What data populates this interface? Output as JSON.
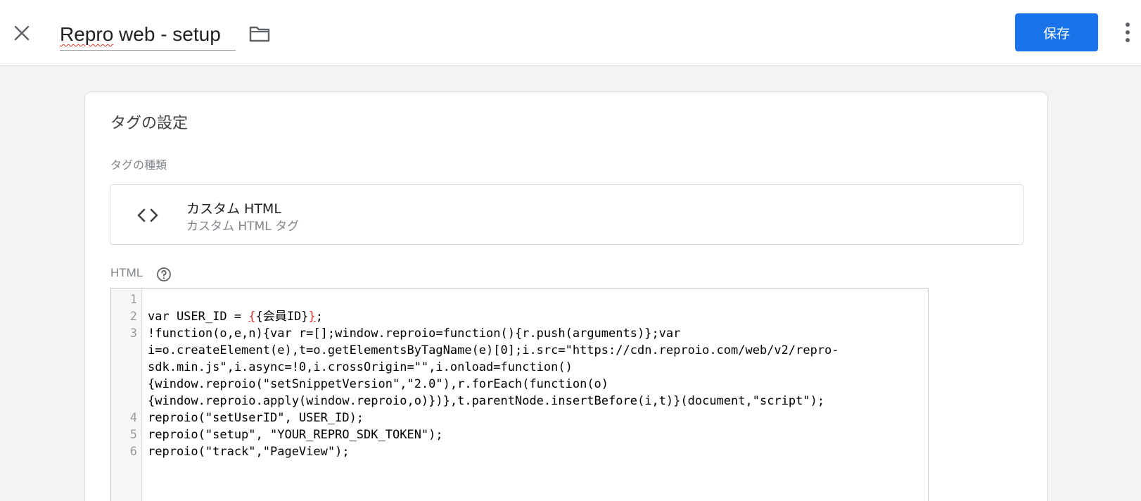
{
  "header": {
    "title_misspelled": "Repro",
    "title_rest": " web - setup",
    "save_label": "保存",
    "icons": [
      "close-icon",
      "folder-icon",
      "more-vert-icon"
    ],
    "accent_color": "#1a73e8"
  },
  "card": {
    "title": "タグの設定",
    "tag_type_label": "タグの種類",
    "tag_type": {
      "name": "カスタム HTML",
      "description": "カスタム HTML タグ",
      "icon": "code-brackets-icon"
    },
    "html_label": "HTML",
    "help_icon": "help-circle-icon"
  },
  "editor": {
    "line_numbers": [
      "1",
      "2",
      "3",
      "4",
      "5",
      "6"
    ],
    "line2_prefix": "var USER_ID = ",
    "line2_open": "{",
    "line2_var": "{会員ID}",
    "line2_close": "}",
    "line2_suffix": ";",
    "line3": "!function(o,e,n){var r=[];window.reproio=function(){r.push(arguments)};var\ni=o.createElement(e),t=o.getElementsByTagName(e)[0];i.src=\"https://cdn.reproio.com/web/v2/repro-\nsdk.min.js\",i.async=!0,i.crossOrigin=\"\",i.onload=function()\n{window.reproio(\"setSnippetVersion\",\"2.0\"),r.forEach(function(o)\n{window.reproio.apply(window.reproio,o)})},t.parentNode.insertBefore(i,t)}(document,\"script\");",
    "line4": "reproio(\"setUserID\", USER_ID);",
    "line5": "reproio(\"setup\", \"YOUR_REPRO_SDK_TOKEN\");",
    "line6": "reproio(\"track\",\"PageView\");"
  }
}
